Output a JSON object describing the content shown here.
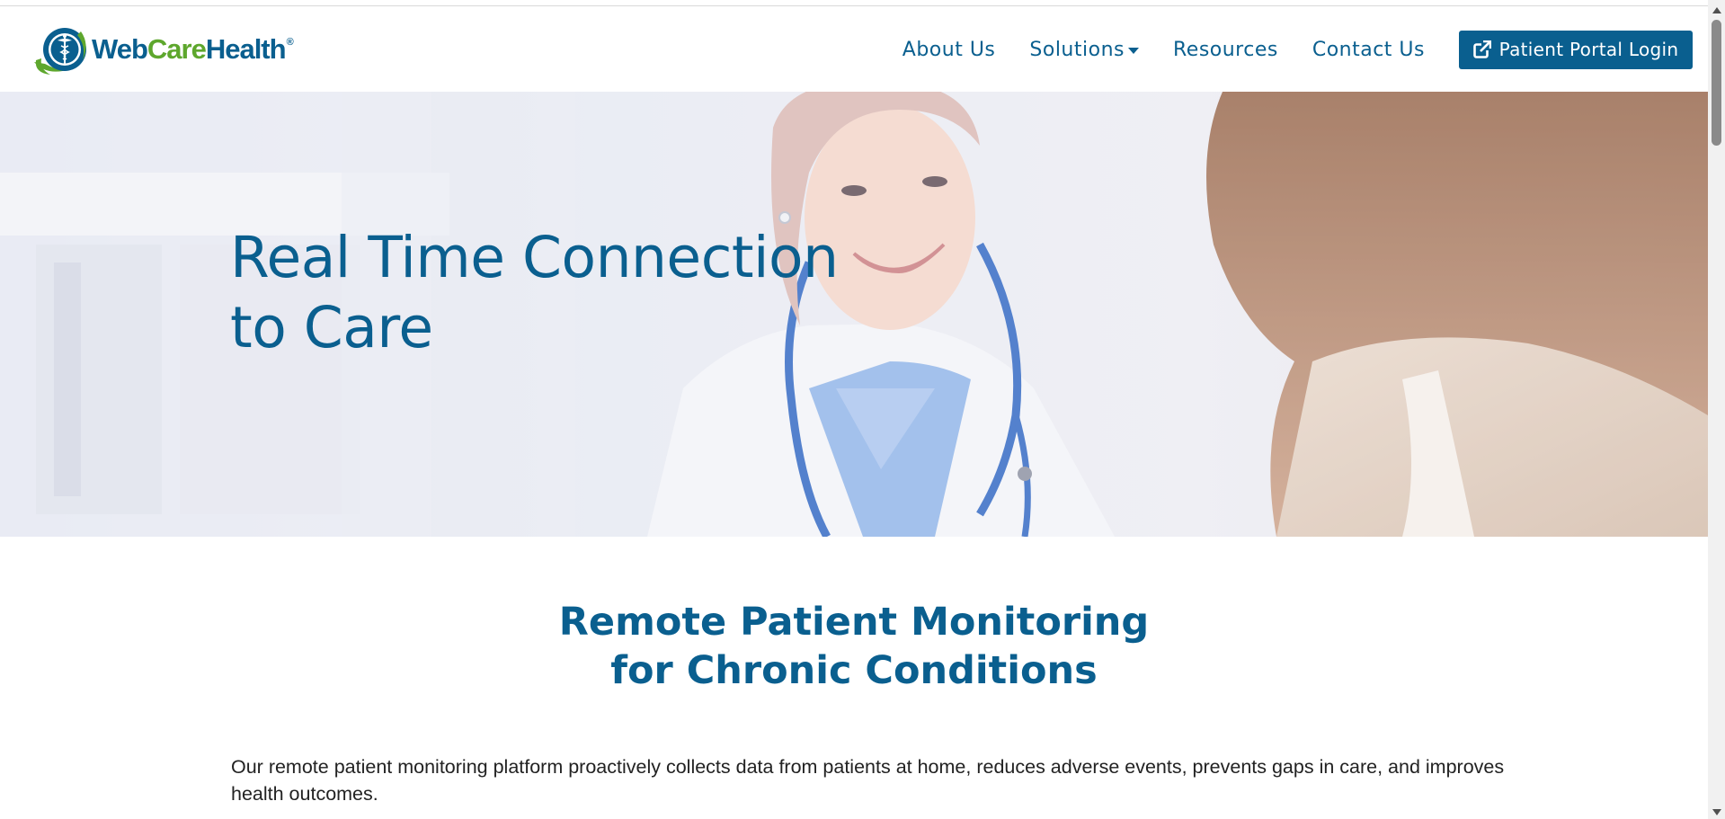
{
  "brand": {
    "name_part1": "Web",
    "name_part2": "Care",
    "name_part3": "Health",
    "registered": "®"
  },
  "nav": {
    "about": "About Us",
    "solutions": "Solutions",
    "resources": "Resources",
    "contact": "Contact Us",
    "portal": "Patient Portal Login"
  },
  "hero": {
    "title_line1": "Real Time Connection",
    "title_line2": "to Care"
  },
  "section": {
    "title_line1": "Remote Patient Monitoring",
    "title_line2": "for Chronic Conditions",
    "body": "Our remote patient monitoring platform proactively collects data from patients at home, reduces adverse events, prevents gaps in care, and improves health outcomes."
  },
  "colors": {
    "brand_blue": "#0a5f8f",
    "brand_green": "#5ea72d"
  }
}
